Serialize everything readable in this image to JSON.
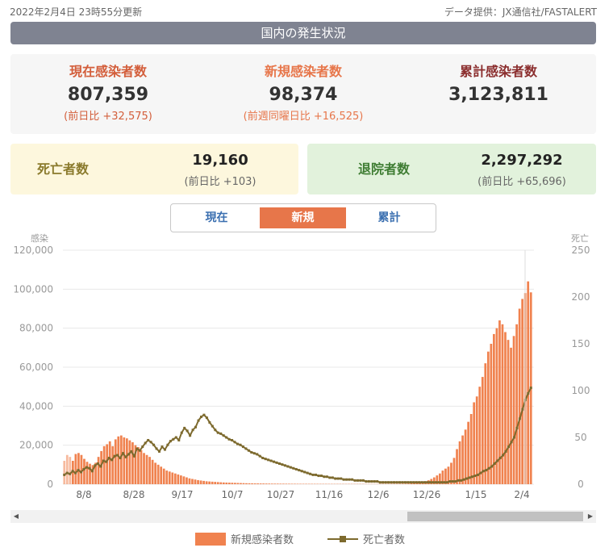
{
  "header": {
    "updated": "2022年2月4日 23時55分更新",
    "source": "データ提供：JX通信社/FASTALERT"
  },
  "banner": {
    "title": "国内の発生状況"
  },
  "stats": [
    {
      "label": "現在感染者数",
      "value": "807,359",
      "sub": "(前日比 +32,575)"
    },
    {
      "label": "新規感染者数",
      "value": "98,374",
      "sub": "(前週同曜日比 +16,525)"
    },
    {
      "label": "累計感染者数",
      "value": "3,123,811",
      "sub": ""
    }
  ],
  "deaths": {
    "label": "死亡者数",
    "value": "19,160",
    "sub": "(前日比 +103)"
  },
  "discharged": {
    "label": "退院者数",
    "value": "2,297,292",
    "sub": "(前日比 +65,696)"
  },
  "toggle": {
    "current": "現在",
    "new": "新規",
    "cumulative": "累計",
    "selected": "新規"
  },
  "colors": {
    "bar": "#f0824f",
    "line": "#7d6a2e",
    "accent": "#e7764a",
    "deathsBg": "#fdf7dd",
    "dischargedBg": "#e2f2dc"
  },
  "chart_data": {
    "type": "bar",
    "left_axis_title": "感染",
    "right_axis_title": "死亡",
    "left_ticks": [
      "0",
      "20,000",
      "40,000",
      "60,000",
      "80,000",
      "100,000",
      "120,000"
    ],
    "right_ticks": [
      "0",
      "50",
      "100",
      "150",
      "200",
      "250"
    ],
    "ylim_left": [
      0,
      120000
    ],
    "ylim_right": [
      0,
      250
    ],
    "x_ticks": [
      "8/8",
      "8/28",
      "9/17",
      "10/7",
      "10/27",
      "11/16",
      "12/6",
      "12/26",
      "1/15",
      "2/4"
    ],
    "legend": [
      "新規感染者数",
      "死亡者数"
    ],
    "grid": true,
    "series": [
      {
        "name": "新規感染者数",
        "kind": "bar",
        "values": [
          12000,
          15000,
          14000,
          12000,
          15500,
          16000,
          15000,
          13000,
          11500,
          10500,
          9800,
          11000,
          14000,
          17000,
          19500,
          20500,
          22000,
          19500,
          23000,
          24500,
          25000,
          24000,
          23500,
          22500,
          21500,
          20000,
          19000,
          17500,
          16000,
          15000,
          14000,
          12500,
          11000,
          10000,
          9000,
          8000,
          7000,
          6500,
          6000,
          5500,
          5000,
          4500,
          4000,
          3500,
          3000,
          2700,
          2400,
          2100,
          1900,
          1700,
          1500,
          1400,
          1300,
          1200,
          1100,
          1000,
          900,
          850,
          800,
          750,
          700,
          650,
          600,
          550,
          500,
          480,
          450,
          420,
          400,
          380,
          360,
          340,
          320,
          300,
          290,
          280,
          270,
          260,
          250,
          240,
          230,
          220,
          210,
          200,
          200,
          195,
          190,
          185,
          180,
          175,
          170,
          165,
          160,
          155,
          150,
          150,
          148,
          145,
          142,
          140,
          138,
          136,
          134,
          132,
          130,
          128,
          126,
          124,
          122,
          120,
          125,
          130,
          135,
          140,
          150,
          160,
          170,
          180,
          200,
          220,
          250,
          300,
          400,
          550,
          700,
          900,
          1200,
          1500,
          2000,
          2700,
          3500,
          4500,
          5500,
          7000,
          8000,
          9000,
          11000,
          13500,
          18000,
          22000,
          25000,
          28000,
          32000,
          36000,
          42000,
          45000,
          50000,
          55000,
          62000,
          68000,
          72000,
          77000,
          80000,
          84000,
          82000,
          78000,
          74000,
          70000,
          76000,
          82000,
          90000,
          95000,
          98000,
          104000,
          98374
        ]
      },
      {
        "name": "死亡者数",
        "kind": "line",
        "values": [
          10,
          12,
          11,
          14,
          12,
          15,
          13,
          16,
          18,
          17,
          14,
          20,
          22,
          19,
          25,
          24,
          28,
          26,
          30,
          31,
          28,
          33,
          29,
          32,
          35,
          30,
          38,
          36,
          40,
          44,
          47,
          45,
          42,
          38,
          35,
          40,
          37,
          42,
          46,
          48,
          50,
          47,
          55,
          60,
          57,
          52,
          58,
          61,
          68,
          72,
          74,
          71,
          66,
          62,
          58,
          55,
          54,
          52,
          50,
          48,
          47,
          45,
          43,
          42,
          40,
          38,
          36,
          34,
          33,
          32,
          30,
          28,
          27,
          26,
          25,
          24,
          23,
          22,
          21,
          20,
          19,
          18,
          17,
          16,
          15,
          14,
          13,
          12,
          11,
          10,
          10,
          9,
          9,
          8,
          8,
          7,
          7,
          6,
          6,
          6,
          5,
          5,
          5,
          5,
          4,
          4,
          4,
          4,
          3,
          3,
          3,
          3,
          3,
          2,
          2,
          2,
          2,
          2,
          2,
          2,
          2,
          2,
          2,
          2,
          2,
          2,
          2,
          2,
          2,
          2,
          2,
          2,
          2,
          2,
          2,
          2,
          2,
          2,
          3,
          3,
          3,
          4,
          4,
          5,
          6,
          7,
          8,
          9,
          10,
          12,
          14,
          15,
          17,
          19,
          22,
          25,
          28,
          31,
          35,
          40,
          45,
          50,
          60,
          70,
          80,
          90,
          97,
          103
        ]
      }
    ]
  }
}
